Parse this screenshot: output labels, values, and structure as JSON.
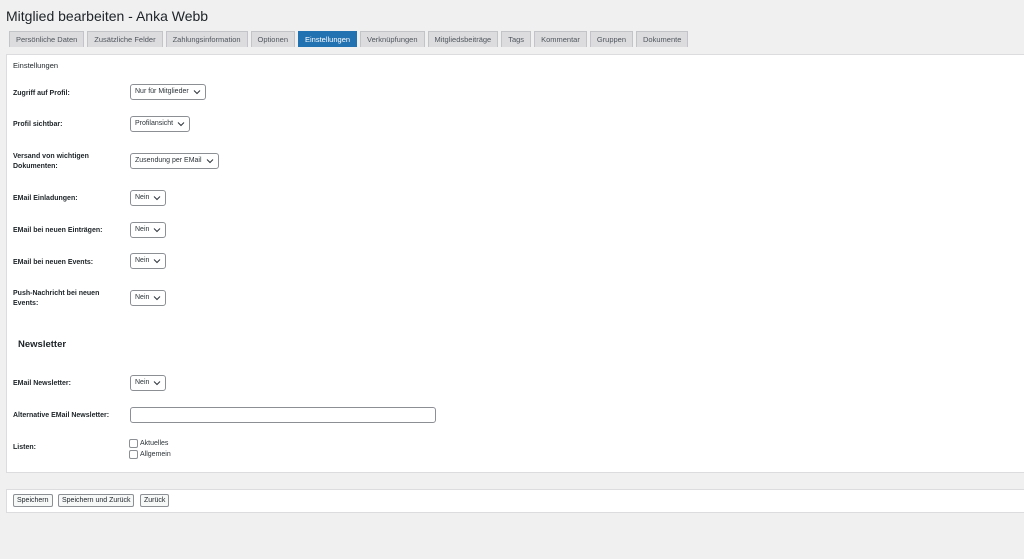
{
  "page": {
    "title": "Mitglied bearbeiten - Anka Webb"
  },
  "tabs": [
    {
      "label": "Persönliche Daten",
      "active": false
    },
    {
      "label": "Zusätzliche Felder",
      "active": false
    },
    {
      "label": "Zahlungsinformation",
      "active": false
    },
    {
      "label": "Optionen",
      "active": false
    },
    {
      "label": "Einstellungen",
      "active": true
    },
    {
      "label": "Verknüpfungen",
      "active": false
    },
    {
      "label": "Mitgliedsbeiträge",
      "active": false
    },
    {
      "label": "Tags",
      "active": false
    },
    {
      "label": "Kommentar",
      "active": false
    },
    {
      "label": "Gruppen",
      "active": false
    },
    {
      "label": "Dokumente",
      "active": false
    }
  ],
  "settings": {
    "section_label": "Einstellungen",
    "fields": [
      {
        "label": "Zugriff auf Profil:",
        "value": "Nur für Mitglieder"
      },
      {
        "label": "Profil sichtbar:",
        "value": "Profilansicht"
      },
      {
        "label": "Versand von wichtigen Dokumenten:",
        "value": "Zusendung per EMail"
      },
      {
        "label": "EMail Einladungen:",
        "value": "Nein"
      },
      {
        "label": "EMail bei neuen Einträgen:",
        "value": "Nein"
      },
      {
        "label": "EMail bei neuen Events:",
        "value": "Nein"
      },
      {
        "label": "Push-Nachricht bei neuen Events:",
        "value": "Nein"
      }
    ]
  },
  "newsletter": {
    "heading": "Newsletter",
    "email_newsletter": {
      "label": "EMail Newsletter:",
      "value": "Nein"
    },
    "alt_email": {
      "label": "Alternative EMail Newsletter:",
      "value": ""
    },
    "lists": {
      "label": "Listen:",
      "options": [
        {
          "label": "Aktuelles",
          "checked": false
        },
        {
          "label": "Allgemein",
          "checked": false
        }
      ]
    }
  },
  "footer": {
    "save_label": "Speichern",
    "save_back_label": "Speichern und Zurück",
    "back_label": "Zurück"
  },
  "colors": {
    "accent": "#2271b1",
    "background": "#f0f0f1"
  }
}
